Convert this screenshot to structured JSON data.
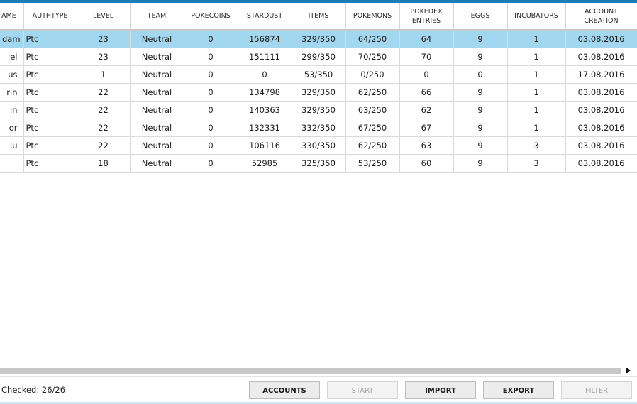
{
  "columns": [
    "AME",
    "AUTHTYPE",
    "LEVEL",
    "TEAM",
    "POKECOINS",
    "STARDUST",
    "ITEMS",
    "POKEMONS",
    "POKEDEX ENTRIES",
    "EGGS",
    "INCUBATORS",
    "ACCOUNT CREATION"
  ],
  "rows": [
    [
      "dam",
      "Ptc",
      "23",
      "Neutral",
      "0",
      "156874",
      "329/350",
      "64/250",
      "64",
      "9",
      "1",
      "03.08.2016"
    ],
    [
      "lel",
      "Ptc",
      "23",
      "Neutral",
      "0",
      "151111",
      "299/350",
      "70/250",
      "70",
      "9",
      "1",
      "03.08.2016"
    ],
    [
      "us",
      "Ptc",
      "1",
      "Neutral",
      "0",
      "0",
      "53/350",
      "0/250",
      "0",
      "0",
      "1",
      "17.08.2016"
    ],
    [
      "rin",
      "Ptc",
      "22",
      "Neutral",
      "0",
      "134798",
      "329/350",
      "62/250",
      "66",
      "9",
      "1",
      "03.08.2016"
    ],
    [
      "in",
      "Ptc",
      "22",
      "Neutral",
      "0",
      "140363",
      "329/350",
      "63/250",
      "62",
      "9",
      "1",
      "03.08.2016"
    ],
    [
      "or",
      "Ptc",
      "22",
      "Neutral",
      "0",
      "132331",
      "332/350",
      "67/250",
      "67",
      "9",
      "1",
      "03.08.2016"
    ],
    [
      "lu",
      "Ptc",
      "22",
      "Neutral",
      "0",
      "106116",
      "330/350",
      "62/250",
      "63",
      "9",
      "3",
      "03.08.2016"
    ],
    [
      "",
      "Ptc",
      "18",
      "Neutral",
      "0",
      "52985",
      "325/350",
      "53/250",
      "60",
      "9",
      "3",
      "03.08.2016"
    ]
  ],
  "selected_row": 0,
  "status": {
    "checked_text": "Checked: 26/26"
  },
  "buttons": {
    "accounts": "ACCOUNTS",
    "start": "START",
    "import": "IMPORT",
    "export": "EXPORT",
    "filter": "FILTER"
  },
  "icons": {
    "scroll_right": "triangle-right-icon"
  },
  "colors": {
    "accent": "#1c7db8",
    "selection": "#a3d6ef"
  }
}
